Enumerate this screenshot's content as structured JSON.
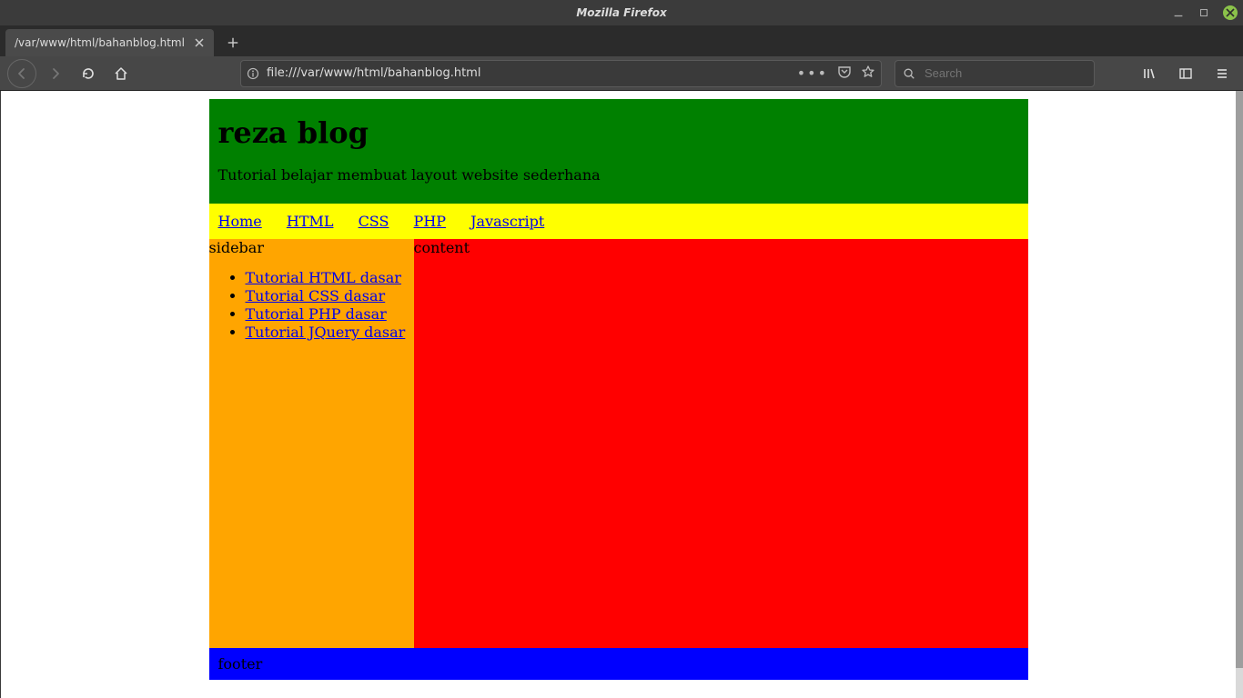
{
  "os": {
    "window_title": "Mozilla Firefox"
  },
  "browser": {
    "tab_title": "/var/www/html/bahanblog.html",
    "url": "file:///var/www/html/bahanblog.html",
    "search_placeholder": "Search"
  },
  "page": {
    "header": {
      "title": "reza blog",
      "subtitle": "Tutorial belajar membuat layout website sederhana"
    },
    "menu": {
      "items": [
        {
          "label": "Home"
        },
        {
          "label": "HTML"
        },
        {
          "label": "CSS"
        },
        {
          "label": "PHP"
        },
        {
          "label": "Javascript"
        }
      ]
    },
    "sidebar": {
      "label": "sidebar",
      "items": [
        {
          "label": "Tutorial HTML dasar"
        },
        {
          "label": "Tutorial CSS dasar"
        },
        {
          "label": "Tutorial PHP dasar"
        },
        {
          "label": "Tutorial JQuery dasar"
        }
      ]
    },
    "content": {
      "label": "content"
    },
    "footer": {
      "label": "footer"
    }
  }
}
